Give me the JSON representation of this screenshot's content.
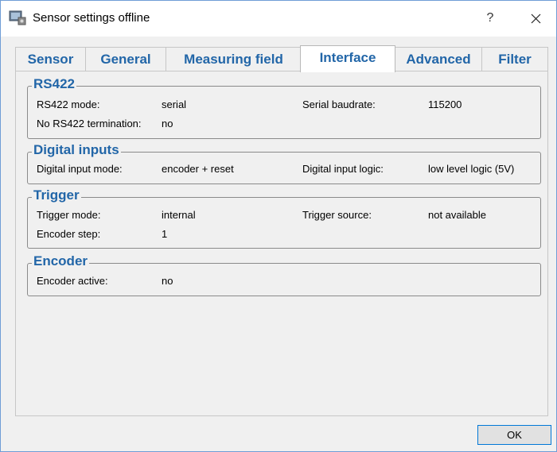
{
  "window": {
    "title": "Sensor settings offline",
    "help_label": "?",
    "icons": {
      "app": "sensor-app-icon",
      "close": "close-icon"
    }
  },
  "tabs": [
    {
      "label": "Sensor",
      "active": false
    },
    {
      "label": "General",
      "active": false
    },
    {
      "label": "Measuring field",
      "active": false
    },
    {
      "label": "Interface",
      "active": true
    },
    {
      "label": "Advanced",
      "active": false
    },
    {
      "label": "Filter",
      "active": false
    }
  ],
  "groups": {
    "rs422": {
      "title": "RS422",
      "mode_label": "RS422 mode:",
      "mode_value": "serial",
      "baud_label": "Serial baudrate:",
      "baud_value": "115200",
      "term_label": "No RS422 termination:",
      "term_value": "no"
    },
    "digital_inputs": {
      "title": "Digital inputs",
      "mode_label": "Digital input mode:",
      "mode_value": "encoder + reset",
      "logic_label": "Digital input logic:",
      "logic_value": "low level logic (5V)"
    },
    "trigger": {
      "title": "Trigger",
      "mode_label": "Trigger mode:",
      "mode_value": "internal",
      "source_label": "Trigger source:",
      "source_value": "not available",
      "step_label": "Encoder step:",
      "step_value": "1"
    },
    "encoder": {
      "title": "Encoder",
      "active_label": "Encoder active:",
      "active_value": "no"
    }
  },
  "buttons": {
    "ok": "OK"
  },
  "colors": {
    "accent": "#2266a8",
    "ok_border": "#0078d7"
  }
}
